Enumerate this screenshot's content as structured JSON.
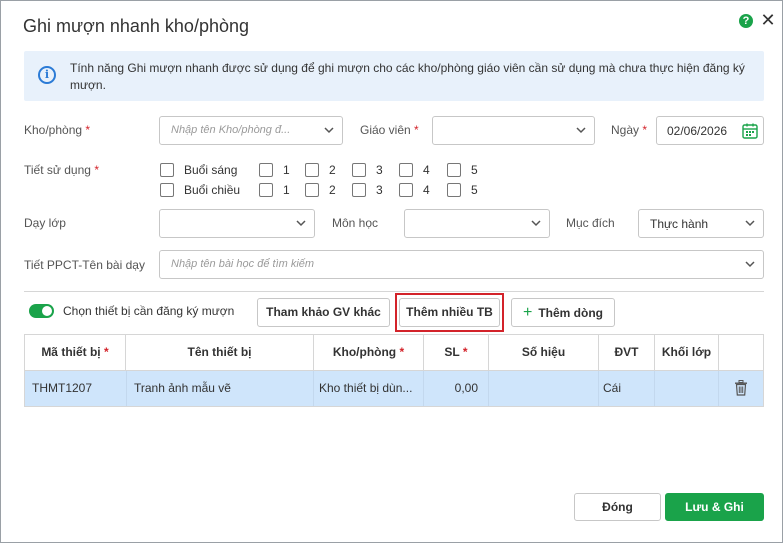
{
  "dialog": {
    "title": "Ghi mượn nhanh kho/phòng",
    "help": "?",
    "close": "✕"
  },
  "info": {
    "icon": "i",
    "text": "Tính năng Ghi mượn nhanh được sử dụng để ghi mượn cho các kho/phòng giáo viên cần sử dụng mà chưa thực hiện đăng ký mượn."
  },
  "form": {
    "room_label": "Kho/phòng",
    "room_placeholder": "Nhập tên Kho/phòng đ...",
    "teacher_label": "Giáo viên",
    "teacher_value": "",
    "date_label": "Ngày",
    "date_value": "02/06/2026",
    "period_label": "Tiết sử dụng",
    "morning_label": "Buổi sáng",
    "afternoon_label": "Buổi chiều",
    "periods": [
      "1",
      "2",
      "3",
      "4",
      "5"
    ],
    "class_label": "Dạy lớp",
    "class_value": "",
    "subject_label": "Môn học",
    "subject_value": "",
    "purpose_label": "Mục đích",
    "purpose_value": "Thực hành",
    "lesson_label": "Tiết PPCT-Tên bài dạy",
    "lesson_placeholder": "Nhập tên bài học để tìm kiếm",
    "required_mark": "*"
  },
  "toolbar": {
    "toggle_label": "Chọn thiết bị cần đăng ký mượn",
    "toggle_on": true,
    "ref_button": "Tham khảo GV khác",
    "add_many_button": "Thêm nhiều TB",
    "add_row_button": "Thêm dòng"
  },
  "table": {
    "headers": [
      "Mã thiết bị",
      "Tên thiết bị",
      "Kho/phòng",
      "SL",
      "Số hiệu",
      "ĐVT",
      "Khối lớp"
    ],
    "rows": [
      {
        "code": "THMT1207",
        "name": "Tranh ảnh mẫu vẽ",
        "room": "Kho thiết bị dùn...",
        "qty": "0,00",
        "serial": "",
        "unit": "Cái",
        "grade": ""
      }
    ]
  },
  "footer": {
    "close_button": "Đóng",
    "save_button": "Lưu & Ghi mượn"
  },
  "colors": {
    "accent": "#1aa34a",
    "required": "#d3232a",
    "info_bg": "#e8f1fb",
    "selected_row": "#cfe5fb"
  }
}
